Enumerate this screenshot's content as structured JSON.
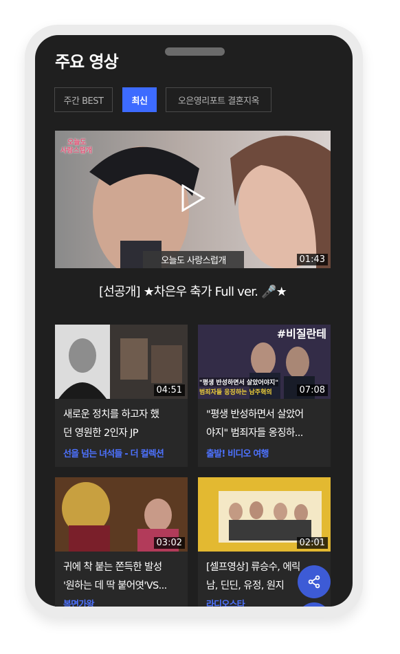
{
  "header": {
    "title": "주요 영상"
  },
  "tabs": [
    {
      "label": "주간 BEST",
      "active": false
    },
    {
      "label": "최신",
      "active": true
    },
    {
      "label": "오은영리포트 결혼지옥",
      "active": false
    }
  ],
  "featured": {
    "title": "[선공개] ★차은우 축가 Full ver. 🎤★",
    "duration": "01:43",
    "caption": "오늘도 사랑스럽개",
    "logo_line1": "오늘도",
    "logo_line2": "사랑스럽개"
  },
  "videos": [
    {
      "title_line1": "새로운 정치를 하고자 했",
      "title_line2": "던 영원한 2인자 JP",
      "channel": "선을 넘는 녀석들 - 더 컬렉션",
      "duration": "04:51"
    },
    {
      "title_line1": "\"평생 반성하면서 살았어",
      "title_line2": "야지\" 범죄자들 옹징하...",
      "channel": "출발! 비디오 여행",
      "duration": "07:08",
      "overlay_tag": "#비질란테",
      "overlay_line1": "\"평생 반성하면서 살았어야지\"",
      "overlay_line2": "범죄자들 응징하는 남주혁의"
    },
    {
      "title_line1": "귀에 착 붙는 쫀득한 발성",
      "title_line2": "'원하는 데 딱 붙어엿'VS...",
      "channel": "복면가왕",
      "duration": "03:02"
    },
    {
      "title_line1": "[셀프영상] 류승수, 에릭",
      "title_line2": "남, 딘딘, 유정, 원지",
      "channel": "라디오스타",
      "duration": "02:01"
    }
  ],
  "share_icon": "share-icon",
  "colors": {
    "accent": "#3d6bff",
    "background": "#1f1f1f",
    "channel": "#4d72ff"
  }
}
